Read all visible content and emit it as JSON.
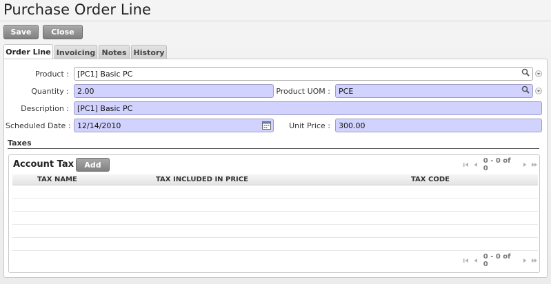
{
  "page": {
    "title": "Purchase Order Line"
  },
  "toolbar": {
    "save_label": "Save",
    "close_label": "Close"
  },
  "tabs": [
    {
      "label": "Order Line",
      "active": true
    },
    {
      "label": "Invoicing",
      "active": false
    },
    {
      "label": "Notes",
      "active": false
    },
    {
      "label": "History",
      "active": false
    }
  ],
  "form": {
    "product": {
      "label": "Product :",
      "value": "[PC1] Basic PC"
    },
    "quantity": {
      "label": "Quantity :",
      "value": "2.00"
    },
    "product_uom": {
      "label": "Product UOM :",
      "value": "PCE"
    },
    "description": {
      "label": "Description :",
      "value": "[PC1] Basic PC"
    },
    "scheduled_date": {
      "label": "Scheduled Date :",
      "value": "12/14/2010"
    },
    "unit_price": {
      "label": "Unit Price :",
      "value": "300.00"
    }
  },
  "taxes": {
    "section_label": "Taxes",
    "grid_title": "Account Tax",
    "add_label": "Add",
    "pager_text": "0 - 0 of 0",
    "columns": [
      "TAX NAME",
      "TAX INCLUDED IN PRICE",
      "TAX CODE"
    ],
    "rows": []
  },
  "colors": {
    "required_field": "#d2d2ff",
    "button": "#8c8c8c",
    "panel_border": "#c8c8c8"
  },
  "icons": [
    "search-icon",
    "dropdown-arrow-icon",
    "calendar-icon",
    "first-page-icon",
    "prev-page-icon",
    "next-page-icon",
    "last-page-icon"
  ]
}
